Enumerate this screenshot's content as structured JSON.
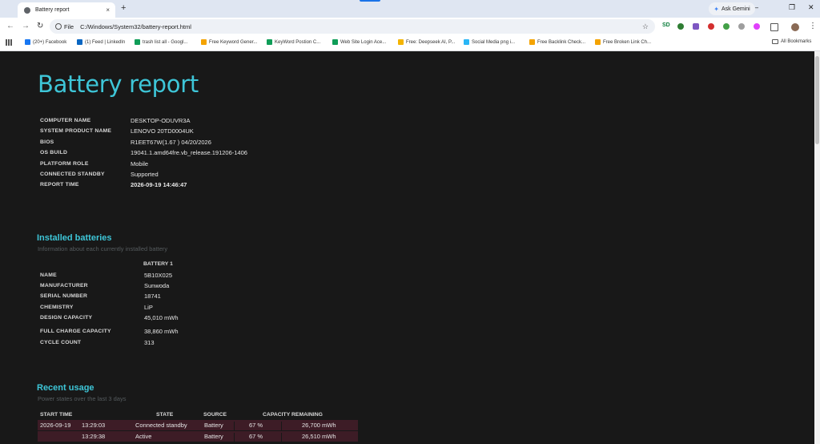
{
  "browser": {
    "tab_title": "Battery report",
    "tab_close": "×",
    "new_tab": "+",
    "window_controls": [
      "—",
      "❐",
      "✕"
    ],
    "nav_icons": [
      "←",
      "→",
      "↻"
    ],
    "address_scheme": "File",
    "address_url": "C:/Windows/System32/battery-report.html",
    "star": "☆",
    "ask_gemini": "Ask Gemini",
    "extensions_label": "SD",
    "menu_icon": "⋮",
    "accent_color": "#1a73e8"
  },
  "bookmarks": [
    {
      "label": "(20+) Facebook",
      "color": "#1877f2"
    },
    {
      "label": "(1) Feed | LinkedIn",
      "color": "#0a66c2"
    },
    {
      "label": "trash list all - Googl...",
      "color": "#0f9d58"
    },
    {
      "label": "Free Keyword Gener...",
      "color": "#f4a300"
    },
    {
      "label": "KeyWord Postion C...",
      "color": "#0f9d58"
    },
    {
      "label": "Web Site Login Ace...",
      "color": "#0f9d58"
    },
    {
      "label": "Free: Deepseek AI, P...",
      "color": "#f4b400"
    },
    {
      "label": "Social Media png i...",
      "color": "#29b6f6"
    },
    {
      "label": "Free Backlink Check...",
      "color": "#f4a300"
    },
    {
      "label": "Free Broken Link Ch...",
      "color": "#f4a300"
    }
  ],
  "all_bookmarks": "All Bookmarks",
  "report": {
    "title": "Battery report",
    "title_color": "#3ec6d8",
    "system": [
      {
        "key": "COMPUTER NAME",
        "value": "DESKTOP-ODUVR3A"
      },
      {
        "key": "SYSTEM PRODUCT NAME",
        "value": "LENOVO 20TD0004UK"
      },
      {
        "key": "BIOS",
        "value": "R1EET67W(1.67 ) 04/20/2026"
      },
      {
        "key": "OS BUILD",
        "value": "19041.1.amd64fre.vb_release.191206-1406"
      },
      {
        "key": "PLATFORM ROLE",
        "value": "Mobile"
      },
      {
        "key": "CONNECTED STANDBY",
        "value": "Supported"
      },
      {
        "key": "REPORT TIME",
        "value": "2026-09-19   14:46:47"
      }
    ],
    "installed": {
      "title": "Installed batteries",
      "subtitle": "Information about each currently installed battery",
      "column": "BATTERY 1",
      "rows": [
        {
          "key": "NAME",
          "value": "5B10X025"
        },
        {
          "key": "MANUFACTURER",
          "value": "Sunwoda"
        },
        {
          "key": "SERIAL NUMBER",
          "value": "18741"
        },
        {
          "key": "CHEMISTRY",
          "value": "LiP"
        },
        {
          "key": "DESIGN CAPACITY",
          "value": "45,010 mWh"
        },
        {
          "key": "FULL CHARGE CAPACITY",
          "value": "38,860 mWh"
        },
        {
          "key": "CYCLE COUNT",
          "value": "313"
        }
      ]
    },
    "recent": {
      "title": "Recent usage",
      "subtitle": "Power states over the last 3 days",
      "headers": [
        "START TIME",
        "STATE",
        "SOURCE",
        "CAPACITY REMAINING"
      ],
      "rows": [
        {
          "date": "2026-09-19",
          "time": "13:29:03",
          "state": "Connected standby",
          "source": "Battery",
          "percent": "67 %",
          "mwh": "26,700 mWh"
        },
        {
          "date": "",
          "time": "13:29:38",
          "state": "Active",
          "source": "Battery",
          "percent": "67 %",
          "mwh": "26,510 mWh"
        }
      ],
      "row_color": "#3d1c26"
    }
  }
}
